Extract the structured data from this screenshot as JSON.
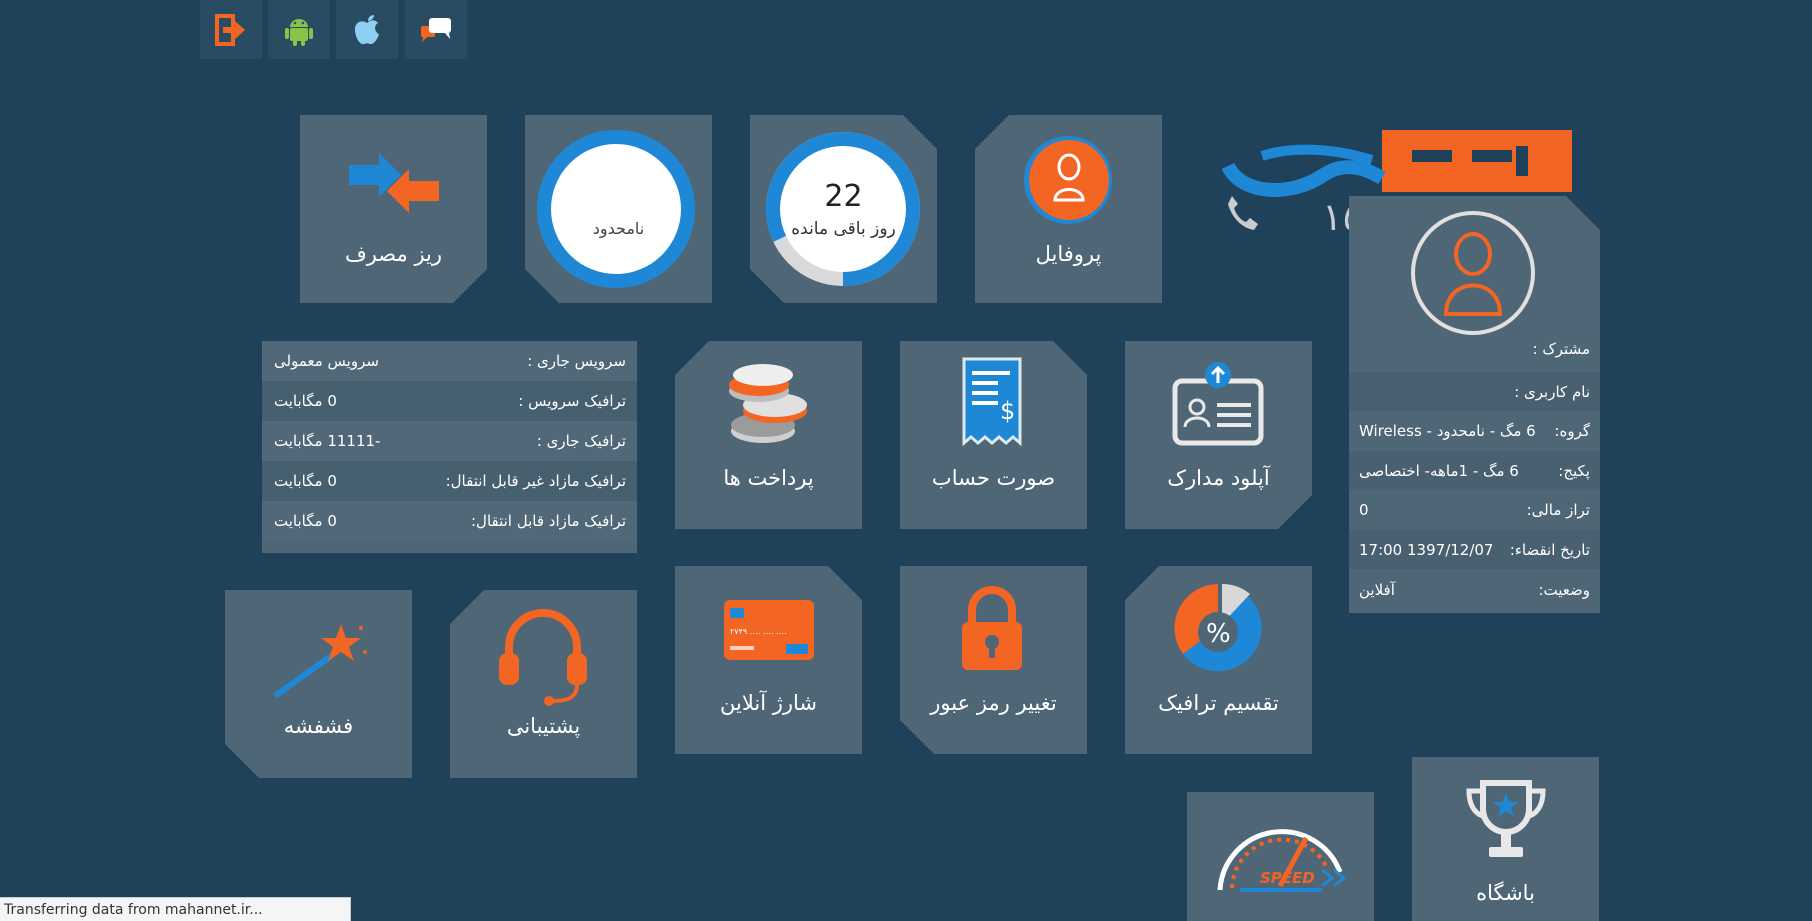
{
  "top_buttons": [
    {
      "icon": "exit-icon"
    },
    {
      "icon": "android-icon"
    },
    {
      "icon": "apple-icon"
    },
    {
      "icon": "chat-icon"
    }
  ],
  "logo": {
    "text": "ماهان نت",
    "phone_digits": "١٥١٤"
  },
  "tiles": {
    "usage_details": "ریز مصرف",
    "unlimited": "نامحدود",
    "days_remaining_value": "22",
    "days_remaining_label": "روز باقی مانده",
    "profile": "پروفایل",
    "payments": "پرداخت ها",
    "invoice": "صورت حساب",
    "upload_documents": "آپلود مدارک",
    "online_charge": "شارژ آنلاین",
    "change_password": "تغییر رمز عبور",
    "traffic_split": "تقسیم ترافیک",
    "fireworks": "فشفشه",
    "support": "پشتیبانی",
    "club": "باشگاه",
    "speed_badge": "SPEED"
  },
  "days_progress": 0.82,
  "service_info": [
    {
      "key": "سرویس جاری :",
      "value": "سرویس معمولی"
    },
    {
      "key": "ترافیک سرویس :",
      "value": "0 مگابایت"
    },
    {
      "key": "ترافیک جاری :",
      "value": "-11111 مگابایت"
    },
    {
      "key": "ترافیک مازاد غیر قابل انتقال:",
      "value": "0 مگابایت"
    },
    {
      "key": "ترافیک مازاد قابل انتقال:",
      "value": "0 مگابایت"
    }
  ],
  "user_panel": {
    "subscriber_label": "مشترک :",
    "username_label": "نام کاربری :",
    "group_label": "گروه:",
    "group_value": "6 مگ - نامحدود - Wireless",
    "package_label": "پکیج:",
    "package_value": "6 مگ - 1ماهه- اختصاصی",
    "balance_label": "تراز مالی:",
    "balance_value": "0",
    "expiry_label": "تاریخ انقضاء:",
    "expiry_value": "1397/12/07 17:00",
    "status_label": "وضعیت:",
    "status_value": "آفلاین"
  },
  "status_bar": "Transferring data from mahannet.ir...",
  "colors": {
    "background": "#1f4159",
    "tile": "#4f6677",
    "orange": "#f26522",
    "blue": "#1e88d6"
  }
}
